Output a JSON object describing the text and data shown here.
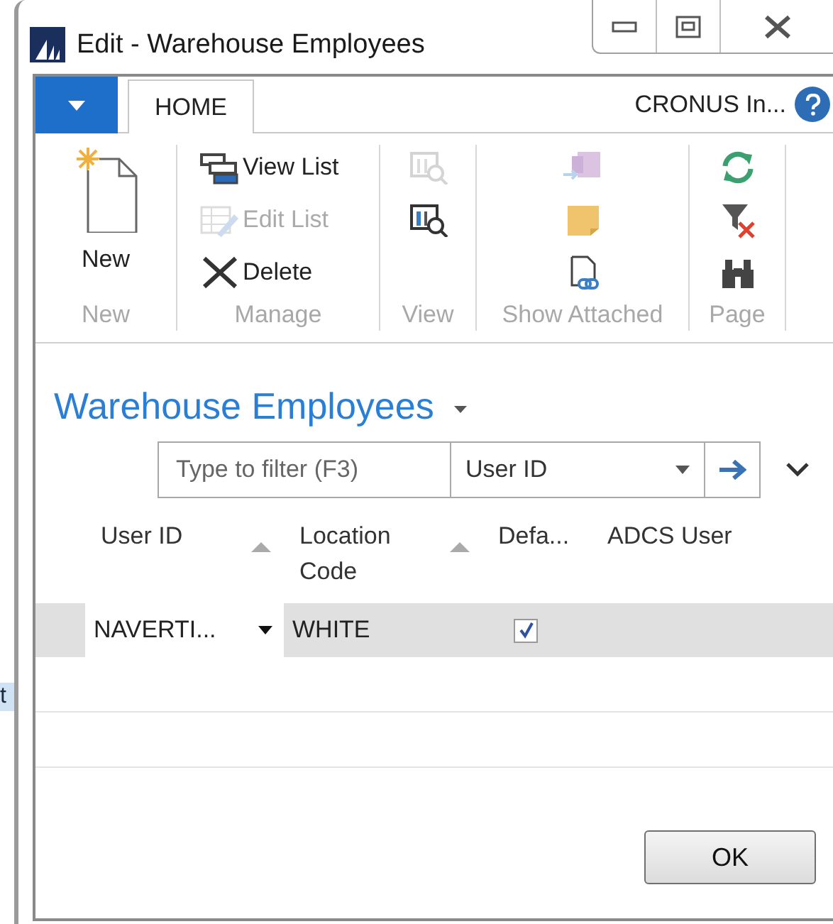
{
  "background_fragment": "t",
  "window": {
    "title": "Edit - Warehouse Employees"
  },
  "ribbon": {
    "tabs": [
      {
        "label": "HOME",
        "selected": true
      }
    ],
    "company": "CRONUS In...",
    "groups": [
      {
        "label": "New",
        "items": [
          {
            "kind": "large",
            "label": "New",
            "disabled": false
          }
        ]
      },
      {
        "label": "Manage",
        "items": [
          {
            "kind": "small",
            "label": "View List",
            "disabled": false
          },
          {
            "kind": "small",
            "label": "Edit List",
            "disabled": true
          },
          {
            "kind": "small",
            "label": "Delete",
            "disabled": false
          }
        ]
      },
      {
        "label": "View",
        "items": [
          {
            "kind": "icon",
            "disabled": true
          },
          {
            "kind": "icon",
            "disabled": false
          }
        ]
      },
      {
        "label": "Show Attached",
        "items": [
          {
            "kind": "icon",
            "disabled": true
          },
          {
            "kind": "icon",
            "disabled": false
          },
          {
            "kind": "icon",
            "disabled": false
          }
        ]
      },
      {
        "label": "Page",
        "items": [
          {
            "kind": "icon",
            "disabled": false
          },
          {
            "kind": "icon",
            "disabled": false
          },
          {
            "kind": "icon",
            "disabled": false
          }
        ]
      }
    ]
  },
  "page_title": "Warehouse Employees",
  "filter": {
    "placeholder": "Type to filter (F3)",
    "field": "User ID"
  },
  "table": {
    "columns": [
      {
        "label": "User ID",
        "sort_arrow": true
      },
      {
        "label": "Location Code",
        "sort_arrow": true
      },
      {
        "label": "Defa...",
        "sort_arrow": false
      },
      {
        "label": "ADCS User",
        "sort_arrow": false
      }
    ],
    "rows": [
      {
        "user_id": "NAVERTI...",
        "location_code": "WHITE",
        "default": true,
        "selected": true
      }
    ]
  },
  "buttons": [
    "OK"
  ]
}
